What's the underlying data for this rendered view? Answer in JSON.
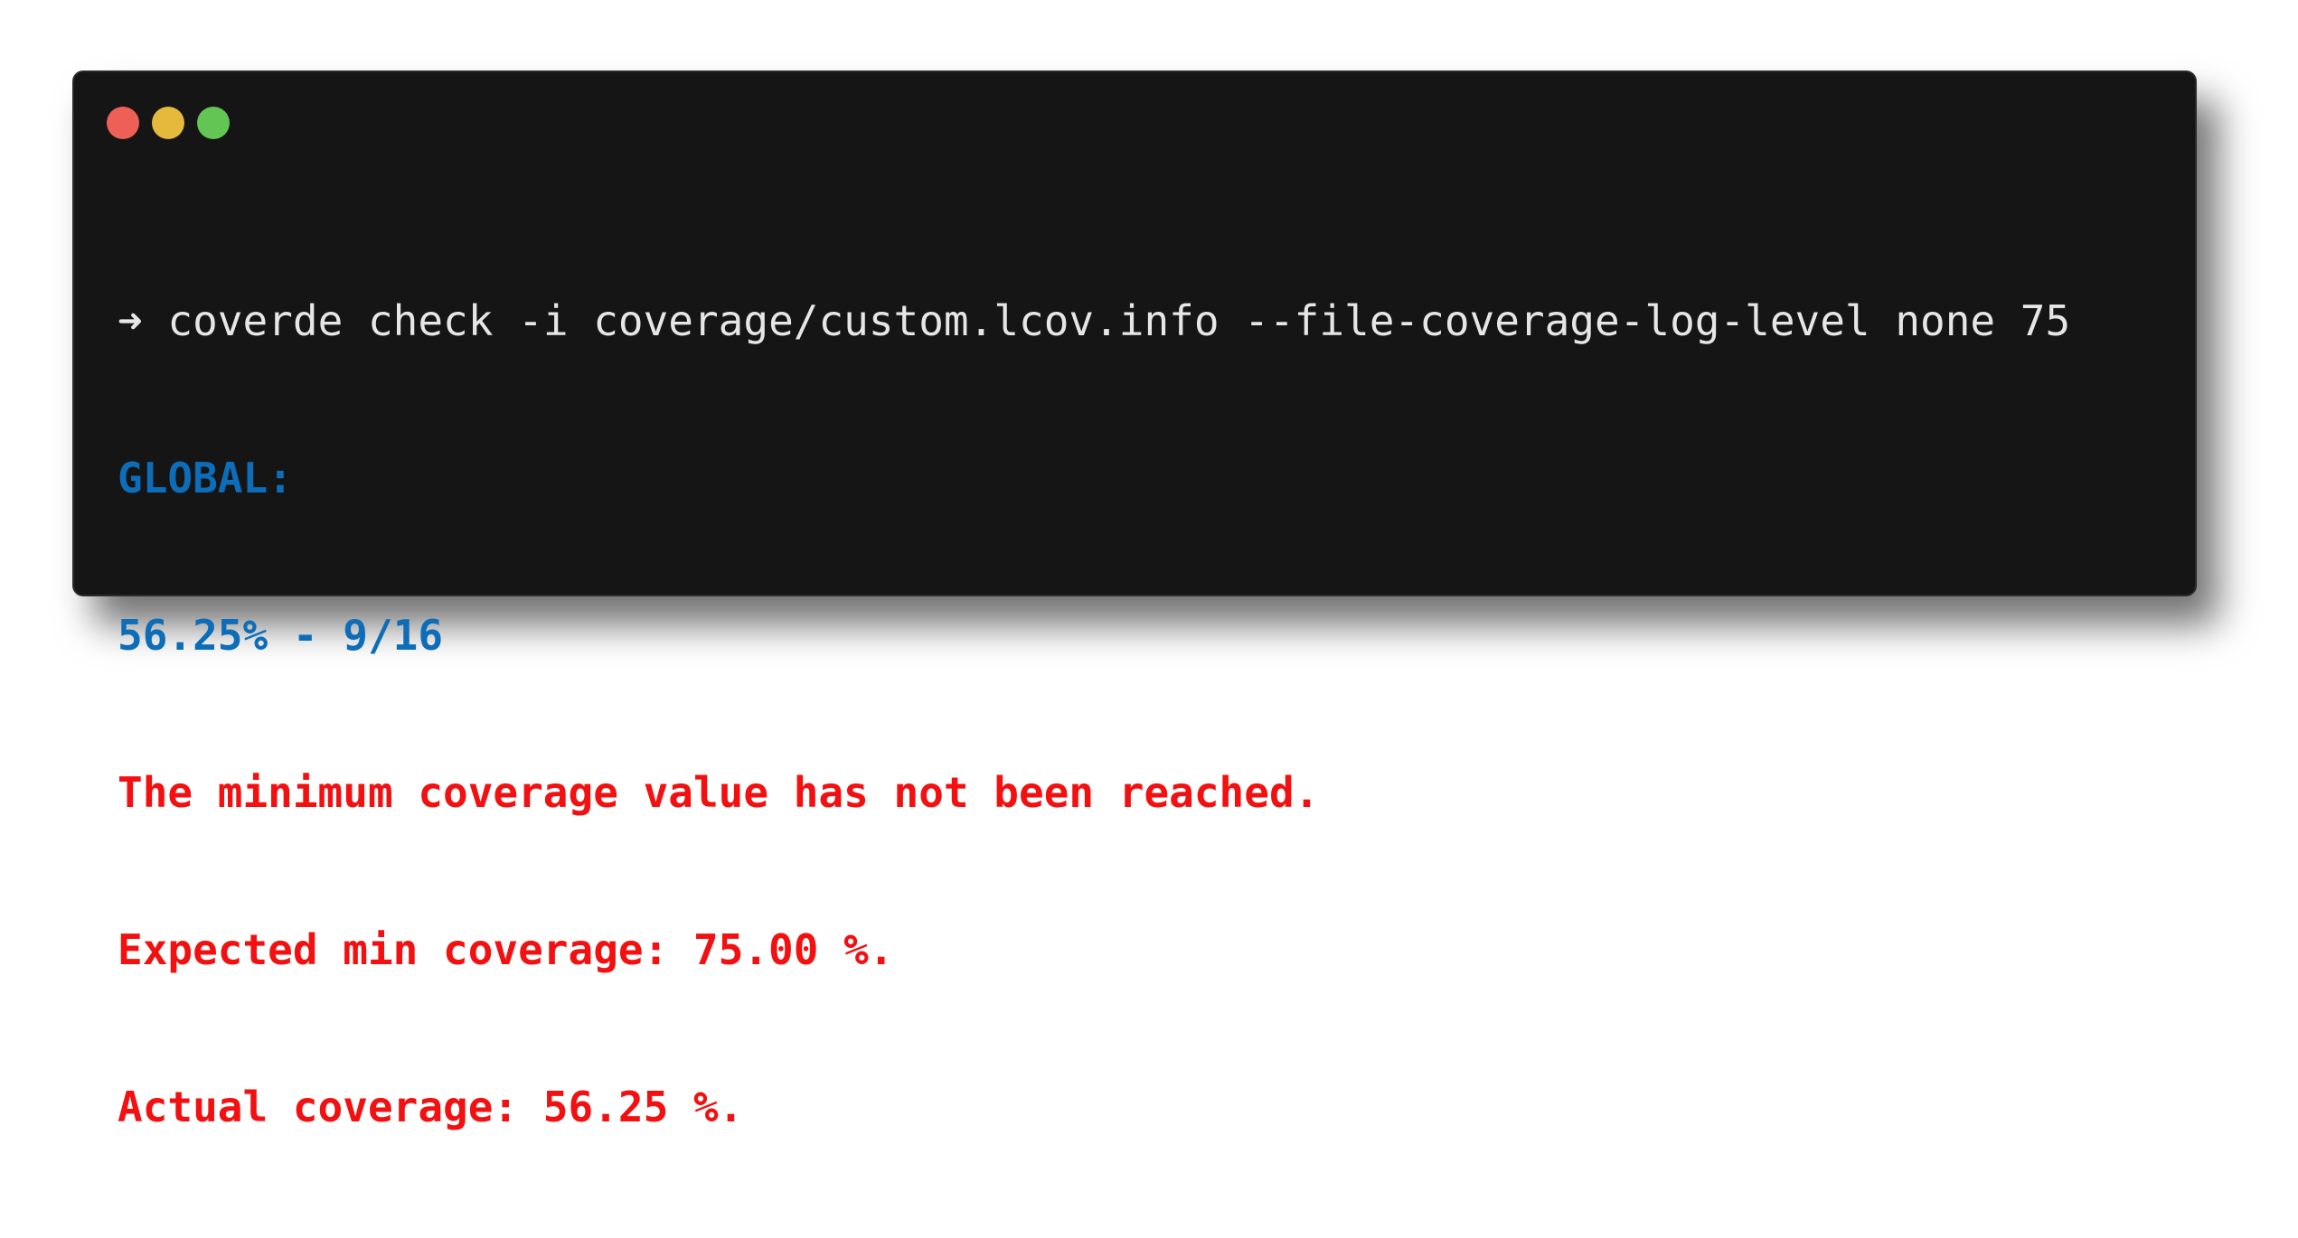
{
  "window": {
    "controls": [
      {
        "name": "close",
        "color": "#ee5f57"
      },
      {
        "name": "minimize",
        "color": "#e5b93c"
      },
      {
        "name": "maximize",
        "color": "#62c554"
      }
    ]
  },
  "colors": {
    "background": "#151515",
    "command": "#e6e6e6",
    "info": "#0d6db8",
    "error": "#f21010"
  },
  "terminal": {
    "prompt_symbol": "➜",
    "command": "coverde check -i coverage/custom.lcov.info --file-coverage-log-level none 75",
    "global_label": "GLOBAL:",
    "global_value": "56.25% - 9/16",
    "error_message": "The minimum coverage value has not been reached.",
    "expected_line": "Expected min coverage: 75.00 %.",
    "actual_line": "Actual coverage: 56.25 %."
  }
}
